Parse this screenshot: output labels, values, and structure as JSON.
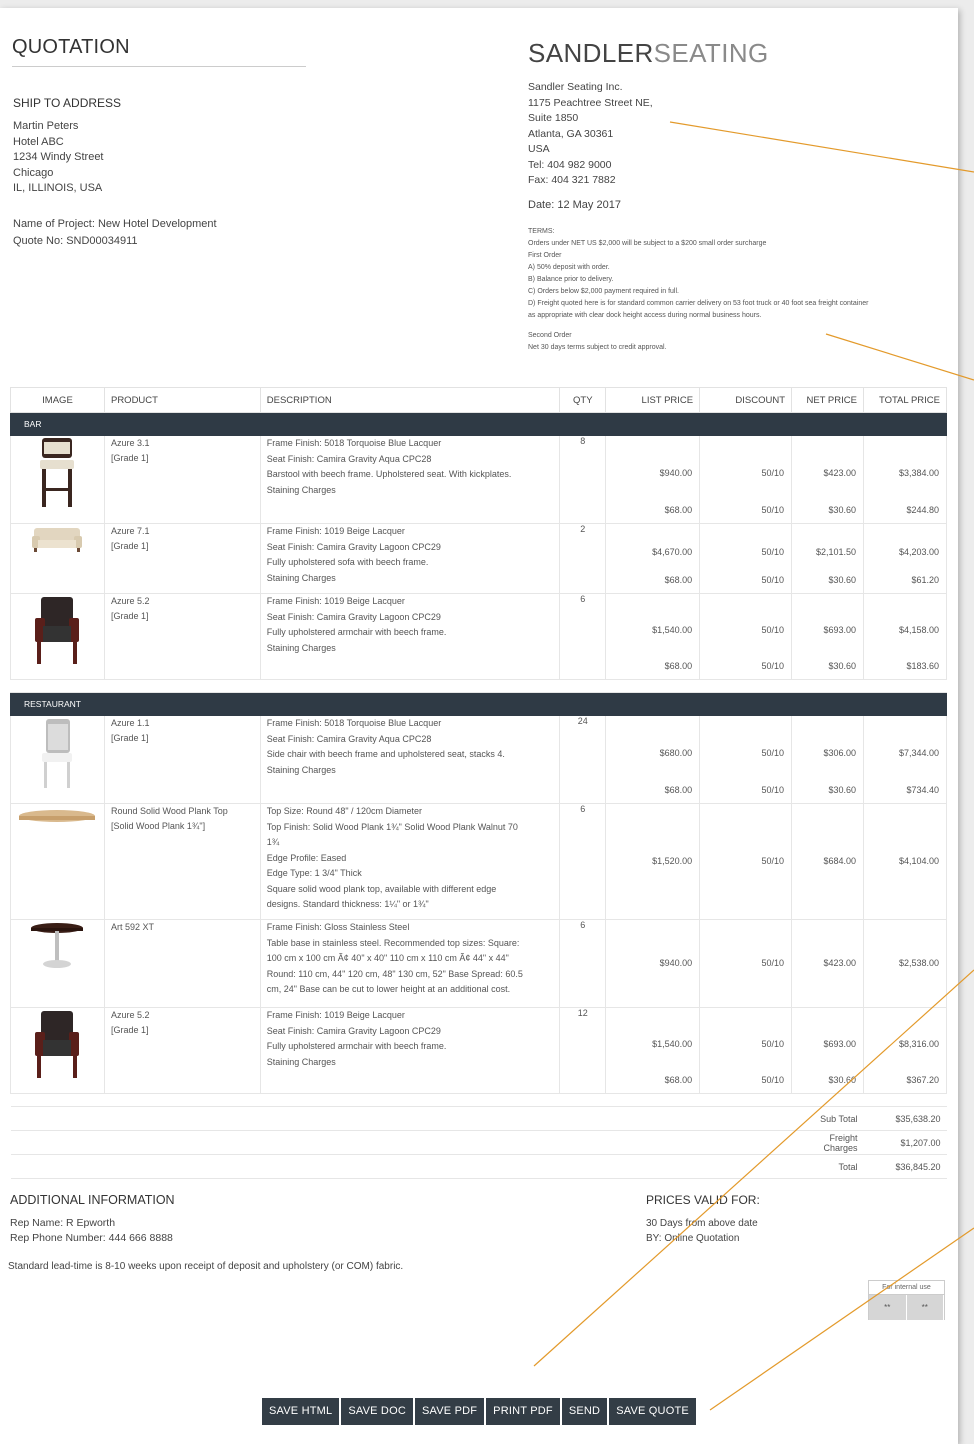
{
  "doc_title": "QUOTATION",
  "ship": {
    "label": "SHIP TO ADDRESS",
    "lines": [
      "Martin Peters",
      "Hotel ABC",
      "1234 Windy Street",
      "Chicago",
      "IL, ILLINOIS, USA"
    ]
  },
  "project": {
    "name": "Name of Project: New Hotel Development",
    "quote": "Quote No: SND00034911"
  },
  "logo": {
    "bold": "SANDLER",
    "light": "SEATING"
  },
  "company_lines": [
    "Sandler Seating Inc.",
    "1175 Peachtree Street NE,",
    "Suite 1850",
    "Atlanta, GA 30361",
    "USA",
    "Tel: 404 982 9000",
    "Fax: 404 321 7882"
  ],
  "date": "Date: 12 May 2017",
  "terms": {
    "lines1": [
      "TERMS:",
      "Orders under NET US $2,000 will be subject to a $200 small order surcharge",
      "First Order",
      "A) 50% deposit with order.",
      "B) Balance prior to delivery.",
      "C) Orders below $2,000 payment required in full.",
      "D) Freight quoted here is for standard common carrier delivery on 53 foot truck or 40 foot sea freight container",
      "as appropriate with clear dock height access during normal business hours."
    ],
    "lines2": [
      "Second Order",
      "Net 30 days terms subject to credit approval."
    ]
  },
  "table": {
    "headers": {
      "image": "IMAGE",
      "product": "PRODUCT",
      "description": "DESCRIPTION",
      "qty": "QTY",
      "list": "LIST PRICE",
      "discount": "DISCOUNT",
      "net": "NET PRICE",
      "total": "TOTAL PRICE"
    },
    "sections": {
      "bar": "BAR",
      "restaurant": "RESTAURANT"
    },
    "rows": [
      {
        "image_icon": "barstool-icon",
        "product": [
          "Azure 3.1",
          "[Grade 1]"
        ],
        "desc": [
          "Frame Finish: 5018 Torquoise Blue Lacquer",
          "Seat Finish: Camira Gravity Aqua CPC28",
          "Barstool with beech frame. Upholstered seat. With kickplates.",
          "Staining Charges"
        ],
        "qty": "8",
        "list": [
          "$940.00",
          "$68.00"
        ],
        "discount": [
          "50/10",
          "50/10"
        ],
        "net": [
          "$423.00",
          "$30.60"
        ],
        "total": [
          "$3,384.00",
          "$244.80"
        ]
      },
      {
        "image_icon": "sofa-icon",
        "product": [
          "Azure 7.1",
          "[Grade 1]"
        ],
        "desc": [
          "Frame Finish: 1019 Beige Lacquer",
          "Seat Finish: Camira Gravity Lagoon CPC29",
          "Fully upholstered sofa with beech frame.",
          "Staining Charges"
        ],
        "qty": "2",
        "list": [
          "$4,670.00",
          "$68.00"
        ],
        "discount": [
          "50/10",
          "50/10"
        ],
        "net": [
          "$2,101.50",
          "$30.60"
        ],
        "total": [
          "$4,203.00",
          "$61.20"
        ]
      },
      {
        "image_icon": "armchair-icon",
        "product": [
          "Azure 5.2",
          "[Grade 1]"
        ],
        "desc": [
          "Frame Finish: 1019 Beige Lacquer",
          "Seat Finish: Camira Gravity Lagoon CPC29",
          "Fully upholstered armchair with beech frame.",
          "Staining Charges"
        ],
        "qty": "6",
        "list": [
          "$1,540.00",
          "$68.00"
        ],
        "discount": [
          "50/10",
          "50/10"
        ],
        "net": [
          "$693.00",
          "$30.60"
        ],
        "total": [
          "$4,158.00",
          "$183.60"
        ]
      },
      {
        "image_icon": "side-chair-icon",
        "product": [
          "Azure 1.1",
          "[Grade 1]"
        ],
        "desc": [
          "Frame Finish: 5018 Torquoise Blue Lacquer",
          "Seat Finish: Camira Gravity Aqua CPC28",
          "Side chair with beech frame and upholstered seat, stacks 4.",
          "Staining Charges"
        ],
        "qty": "24",
        "list": [
          "$680.00",
          "$68.00"
        ],
        "discount": [
          "50/10",
          "50/10"
        ],
        "net": [
          "$306.00",
          "$30.60"
        ],
        "total": [
          "$7,344.00",
          "$734.40"
        ]
      },
      {
        "image_icon": "tabletop-icon",
        "product": [
          "Round Solid Wood Plank Top",
          "[Solid Wood Plank 1¾\"]"
        ],
        "desc": [
          "Top Size: Round 48\" / 120cm Diameter",
          "Top Finish: Solid Wood Plank 1¾\" Solid Wood Plank Walnut 70",
          "1¾",
          "Edge Profile: Eased",
          "Edge Type: 1 3/4\" Thick",
          "Square solid wood plank top, available with different edge",
          "designs. Standard thickness: 1¼\" or 1¾\""
        ],
        "qty": "6",
        "list": [
          "$1,520.00"
        ],
        "discount": [
          "50/10"
        ],
        "net": [
          "$684.00"
        ],
        "total": [
          "$4,104.00"
        ]
      },
      {
        "image_icon": "table-base-icon",
        "product": [
          "Art 592 XT"
        ],
        "desc": [
          "Frame Finish: Gloss Stainless Steel",
          "Table base in stainless steel. Recommended top sizes: Square:",
          "100 cm x 100 cm Ã¢ 40\" x 40\" 110 cm x 110 cm Ã¢ 44\" x 44\"",
          "Round: 110 cm, 44\" 120 cm, 48\" 130 cm, 52\" Base Spread: 60.5",
          "cm, 24\" Base can be cut to lower height at an additional cost."
        ],
        "qty": "6",
        "list": [
          "$940.00"
        ],
        "discount": [
          "50/10"
        ],
        "net": [
          "$423.00"
        ],
        "total": [
          "$2,538.00"
        ]
      },
      {
        "image_icon": "armchair-icon",
        "product": [
          "Azure 5.2",
          "[Grade 1]"
        ],
        "desc": [
          "Frame Finish: 1019 Beige Lacquer",
          "Seat Finish: Camira Gravity Lagoon CPC29",
          "Fully upholstered armchair with beech frame.",
          "Staining Charges"
        ],
        "qty": "12",
        "list": [
          "$1,540.00",
          "$68.00"
        ],
        "discount": [
          "50/10",
          "50/10"
        ],
        "net": [
          "$693.00",
          "$30.60"
        ],
        "total": [
          "$8,316.00",
          "$367.20"
        ]
      }
    ],
    "totals": [
      {
        "label": "Sub Total",
        "value": "$35,638.20"
      },
      {
        "label": "Freight Charges",
        "value": "$1,207.00"
      },
      {
        "label": "Total",
        "value": "$36,845.20"
      }
    ]
  },
  "additional": {
    "title": "ADDITIONAL INFORMATION",
    "rep_name": "Rep Name: R Epworth",
    "rep_phone": "Rep Phone Number: 444 666 8888",
    "lead": "Standard lead-time is 8-10 weeks upon receipt of deposit and upholstery (or COM) fabric."
  },
  "valid": {
    "title": "PRICES VALID FOR:",
    "days": "30 Days from above date",
    "by": "BY: Online Quotation"
  },
  "internal": {
    "caption": "For internal use",
    "cell1": "**",
    "cell2": "**"
  },
  "buttons": [
    "SAVE HTML",
    "SAVE DOC",
    "SAVE PDF",
    "PRINT PDF",
    "SEND",
    "SAVE QUOTE"
  ],
  "colors": {
    "section_bar": "#2f3a45",
    "button": "#333d46",
    "callout_line": "#e39a2b"
  }
}
